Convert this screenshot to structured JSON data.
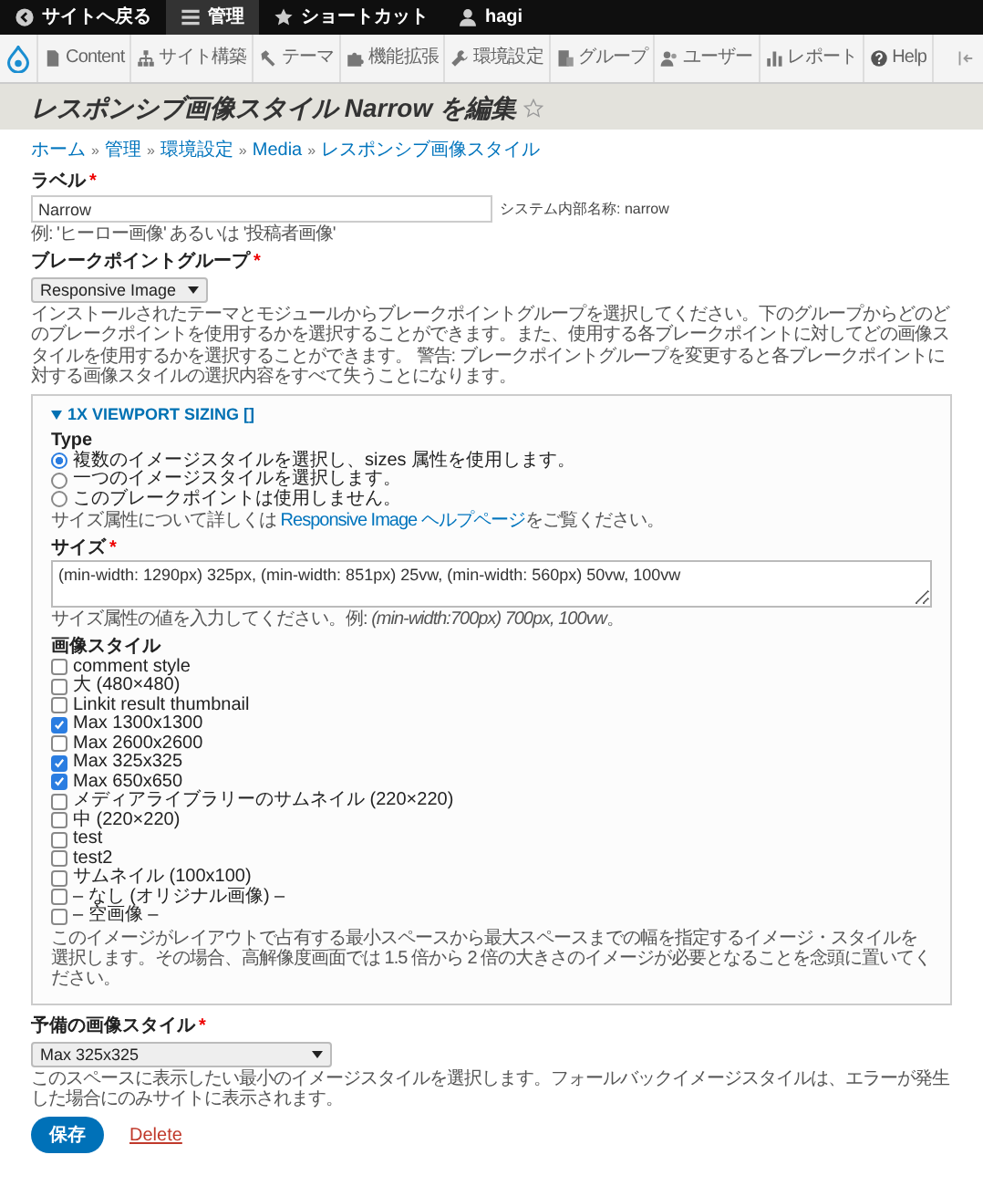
{
  "top_bar": {
    "items": [
      {
        "kind": "back",
        "label": "サイトへ戻る",
        "selected": false
      },
      {
        "kind": "menu",
        "label": "管理",
        "selected": true
      },
      {
        "kind": "star",
        "label": "ショートカット",
        "selected": false
      },
      {
        "kind": "user",
        "label": "hagi",
        "selected": false
      }
    ]
  },
  "admin_menu": {
    "items": [
      {
        "kind": "page",
        "label": "Content"
      },
      {
        "kind": "sitemap",
        "label": "サイト構築"
      },
      {
        "kind": "brush",
        "label": "テーマ"
      },
      {
        "kind": "puzzle",
        "label": "機能拡張"
      },
      {
        "kind": "wrench",
        "label": "環境設定"
      },
      {
        "kind": "building",
        "label": "グループ"
      },
      {
        "kind": "people",
        "label": "ユーザー"
      },
      {
        "kind": "chart",
        "label": "レポート"
      },
      {
        "kind": "help",
        "label": "Help"
      }
    ]
  },
  "page_title": {
    "text": "レスポンシブ画像スタイル Narrow を編集",
    "starred": false
  },
  "breadcrumb": {
    "separator": "»",
    "items": [
      "ホーム",
      "管理",
      "環境設定",
      "Media",
      "レスポンシブ画像スタイル"
    ]
  },
  "label_field": {
    "label": "ラベル",
    "required_mark": "*",
    "value": "Narrow",
    "machine_name": "システム内部名称: narrow",
    "description": "例: 'ヒーロー画像' あるいは '投稿者画像'"
  },
  "breakpoint_group": {
    "label": "ブレークポイントグループ",
    "required_mark": "*",
    "value": "Responsive Image",
    "description": "インストールされたテーマとモジュールからブレークポイントグループを選択してください。下のグループからどのどのブレークポイントを使用するかを選択することができます。また、使用する各ブレークポイントに対してどの画像スタイルを使用するかを選択することができます。 警告: ブレークポイントグループを変更すると各ブレークポイントに対する画像スタイルの選択内容をすべて失うことになります。"
  },
  "fieldset": {
    "title": "1X VIEWPORT SIZING []",
    "expanded": true,
    "type": {
      "label": "Type",
      "options": [
        {
          "label": "複数のイメージスタイルを選択し、sizes 属性を使用します。",
          "selected": true
        },
        {
          "label": "一つのイメージスタイルを選択します。",
          "selected": false
        },
        {
          "label": "このブレークポイントは使用しません。",
          "selected": false
        }
      ],
      "help_before": "サイズ属性について詳しくは",
      "help_link": "Responsive Image ヘルプページ",
      "help_after": "をご覧ください。"
    },
    "sizes": {
      "label": "サイズ",
      "required_mark": "*",
      "value": "(min-width: 1290px) 325px, (min-width: 851px) 25vw, (min-width: 560px) 50vw, 100vw",
      "description": "サイズ属性の値を入力してください。例: *(min-width:700px) 700px, 100vw*。"
    },
    "image_styles": {
      "label": "画像スタイル",
      "items": [
        {
          "label": "comment style",
          "checked": false
        },
        {
          "label": "大 (480×480)",
          "checked": false
        },
        {
          "label": "Linkit result thumbnail",
          "checked": false
        },
        {
          "label": "Max 1300x1300",
          "checked": true
        },
        {
          "label": "Max 2600x2600",
          "checked": false
        },
        {
          "label": "Max 325x325",
          "checked": true
        },
        {
          "label": "Max 650x650",
          "checked": true
        },
        {
          "label": "メディアライブラリーのサムネイル (220×220)",
          "checked": false
        },
        {
          "label": "中 (220×220)",
          "checked": false
        },
        {
          "label": "test",
          "checked": false
        },
        {
          "label": "test2",
          "checked": false
        },
        {
          "label": "サムネイル (100x100)",
          "checked": false
        },
        {
          "label": "– なし (オリジナル画像) –",
          "checked": false
        },
        {
          "label": "– 空画像 –",
          "checked": false
        }
      ],
      "description": "このイメージがレイアウトで占有する最小スペースから最大スペースまでの幅を指定するイメージ・スタイルを選択します。その場合、高解像度画面では 1.5 倍から 2 倍の大きさのイメージが必要となることを念頭に置いてください。"
    }
  },
  "fallback": {
    "label": "予備の画像スタイル",
    "required_mark": "*",
    "value": "Max 325x325",
    "description": "このスペースに表示したい最小のイメージスタイルを選択します。フォールバックイメージスタイルは、エラーが発生した場合にのみサイトに表示されます。"
  },
  "actions": {
    "save": "保存",
    "delete": "Delete"
  }
}
